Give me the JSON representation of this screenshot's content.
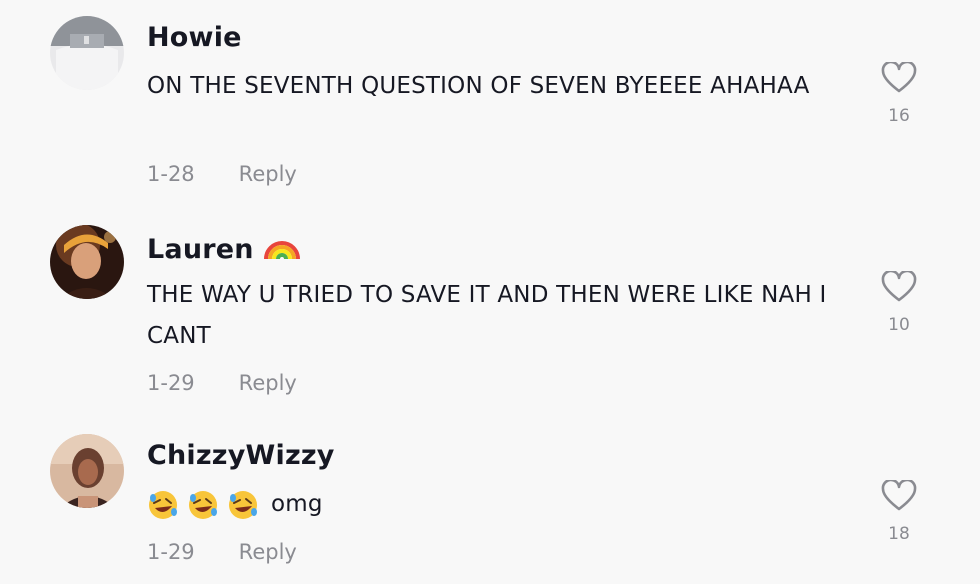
{
  "comments": [
    {
      "username": "Howie",
      "text": "ON THE SEVENTH QUESTION OF SEVEN BYEEEE AHAHAA",
      "date": "1-28",
      "reply_label": "Reply",
      "likes": "16",
      "avatar": "avatar-grey-sweater"
    },
    {
      "username": "Lauren",
      "username_emoji": "rainbow-icon",
      "text": "THE WAY U TRIED TO SAVE IT AND THEN WERE LIKE NAH I CANT",
      "date": "1-29",
      "reply_label": "Reply",
      "likes": "10",
      "avatar": "avatar-selfie-dark"
    },
    {
      "username": "ChizzyWizzy",
      "text": "omg",
      "text_emojis": [
        "rolling-on-floor-laughing-icon",
        "rolling-on-floor-laughing-icon",
        "rolling-on-floor-laughing-icon"
      ],
      "date": "1-29",
      "reply_label": "Reply",
      "likes": "18",
      "avatar": "avatar-selfie-warm"
    }
  ],
  "colors": {
    "background": "#f8f8f8",
    "text_primary": "#161823",
    "text_secondary": "#8a8b91"
  }
}
